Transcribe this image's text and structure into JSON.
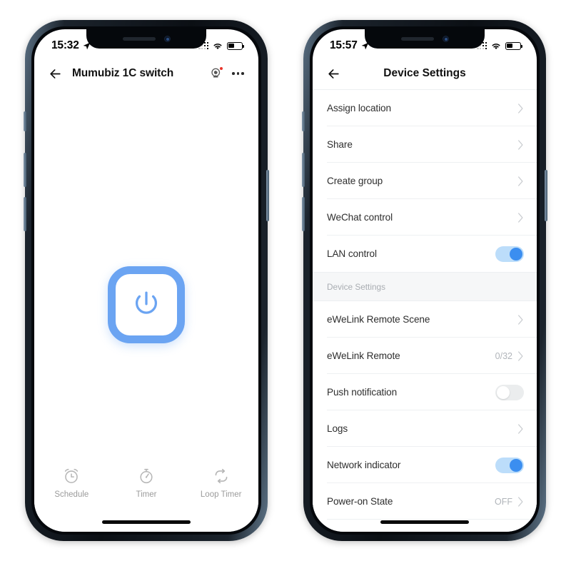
{
  "left_phone": {
    "status_bar": {
      "time": "15:32",
      "location_icon": "location-arrow-icon",
      "signal_icon": "cellular-signal-icon",
      "wifi_icon": "wifi-icon",
      "battery_icon": "battery-icon",
      "battery_level_pct": 42
    },
    "nav": {
      "back_icon": "back-arrow-icon",
      "title": "Mumubiz 1C switch",
      "camera_icon": "camera-icon",
      "more_icon": "more-options-icon"
    },
    "power": {
      "icon": "power-icon",
      "state": "on",
      "accent_color": "#6ba4f2"
    },
    "tabs": [
      {
        "label": "Schedule",
        "icon": "alarm-clock-icon"
      },
      {
        "label": "Timer",
        "icon": "stopwatch-icon"
      },
      {
        "label": "Loop Timer",
        "icon": "loop-repeat-icon"
      }
    ]
  },
  "right_phone": {
    "status_bar": {
      "time": "15:57",
      "location_icon": "location-arrow-icon",
      "signal_icon": "cellular-signal-icon",
      "wifi_icon": "wifi-icon",
      "battery_icon": "battery-icon",
      "battery_level_pct": 42
    },
    "nav": {
      "back_icon": "back-arrow-icon",
      "title": "Device Settings"
    },
    "section_header": "Device Settings",
    "group_one": [
      {
        "label": "Assign location",
        "type": "chevron",
        "value": ""
      },
      {
        "label": "Share",
        "type": "chevron",
        "value": ""
      },
      {
        "label": "Create group",
        "type": "chevron",
        "value": ""
      },
      {
        "label": "WeChat control",
        "type": "chevron",
        "value": ""
      },
      {
        "label": "LAN control",
        "type": "toggle",
        "value": "on"
      }
    ],
    "group_two": [
      {
        "label": "eWeLink Remote Scene",
        "type": "chevron",
        "value": ""
      },
      {
        "label": "eWeLink Remote",
        "type": "chevron",
        "value": "0/32"
      },
      {
        "label": "Push notification",
        "type": "toggle",
        "value": "off"
      },
      {
        "label": "Logs",
        "type": "chevron",
        "value": ""
      },
      {
        "label": "Network indicator",
        "type": "toggle",
        "value": "on"
      },
      {
        "label": "Power-on State",
        "type": "chevron",
        "value": "OFF"
      }
    ]
  },
  "colors": {
    "accent_blue": "#3b8ef0",
    "toggle_track_on": "#bcddfa",
    "toggle_track_off": "#ebedee",
    "power_border": "#6ba4f2",
    "text_primary": "#2e2e2e",
    "text_muted": "#b1b5ba",
    "frame": "#0b0f14"
  }
}
